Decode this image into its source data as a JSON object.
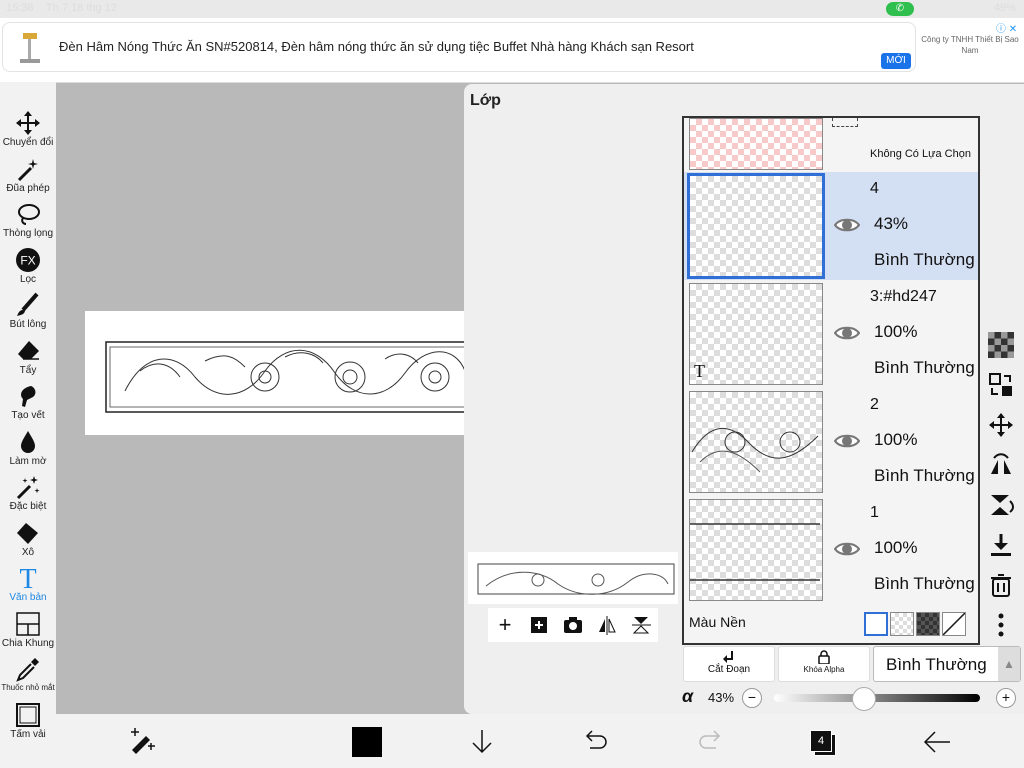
{
  "status": {
    "time": "15:38",
    "date": "Th 7 18 thg 12",
    "battery": "49%"
  },
  "ad": {
    "text": "Đèn Hâm Nóng Thức Ăn SN#520814, Đèn hâm nóng thức ăn sử dụng tiệc Buffet Nhà hàng Khách sạn Resort",
    "badge": "MỚI",
    "sponsor": "Công ty TNHH Thiết Bị Sao Nam",
    "icon": "adchoices-icon"
  },
  "tools": [
    {
      "label": "Chuyển đổi",
      "icon": "move-arrows-icon"
    },
    {
      "label": "Đũa phép",
      "icon": "magic-wand-icon"
    },
    {
      "label": "Thòng lọng",
      "icon": "lasso-icon"
    },
    {
      "label": "Lọc",
      "icon": "fx-filter-icon"
    },
    {
      "label": "Bút lông",
      "icon": "brush-icon"
    },
    {
      "label": "Tẩy",
      "icon": "eraser-icon"
    },
    {
      "label": "Tạo vết",
      "icon": "smudge-icon"
    },
    {
      "label": "Làm mờ",
      "icon": "blur-drop-icon"
    },
    {
      "label": "Đặc biệt",
      "icon": "special-wand-icon"
    },
    {
      "label": "Xô",
      "icon": "bucket-icon"
    },
    {
      "label": "Văn bản",
      "icon": "text-icon"
    },
    {
      "label": "Chia Khung",
      "icon": "frame-divider-icon"
    },
    {
      "label": "Thuốc nhỏ mắt",
      "icon": "eyedropper-icon"
    },
    {
      "label": "Tấm vải",
      "icon": "canvas-icon"
    }
  ],
  "panel": {
    "title": "Lớp",
    "selection_label": "Không Có Lựa Chọn",
    "layers": [
      {
        "name": "4",
        "opacity": "43%",
        "mode": "Bình Thường",
        "selected": true
      },
      {
        "name": "3:#hd247",
        "opacity": "100%",
        "mode": "Bình Thường",
        "selected": false,
        "text_marker": "T"
      },
      {
        "name": "2",
        "opacity": "100%",
        "mode": "Bình Thường",
        "selected": false
      },
      {
        "name": "1",
        "opacity": "100%",
        "mode": "Bình Thường",
        "selected": false
      }
    ],
    "background_label": "Màu Nền",
    "clip_label": "Cắt Đoạn",
    "alpha_lock_label": "Khóa Alpha",
    "blend_mode": "Bình Thường",
    "alpha_symbol": "α",
    "alpha_value": "43%",
    "alpha_fraction": 0.43
  },
  "bottom": {
    "layer_count": "4"
  }
}
